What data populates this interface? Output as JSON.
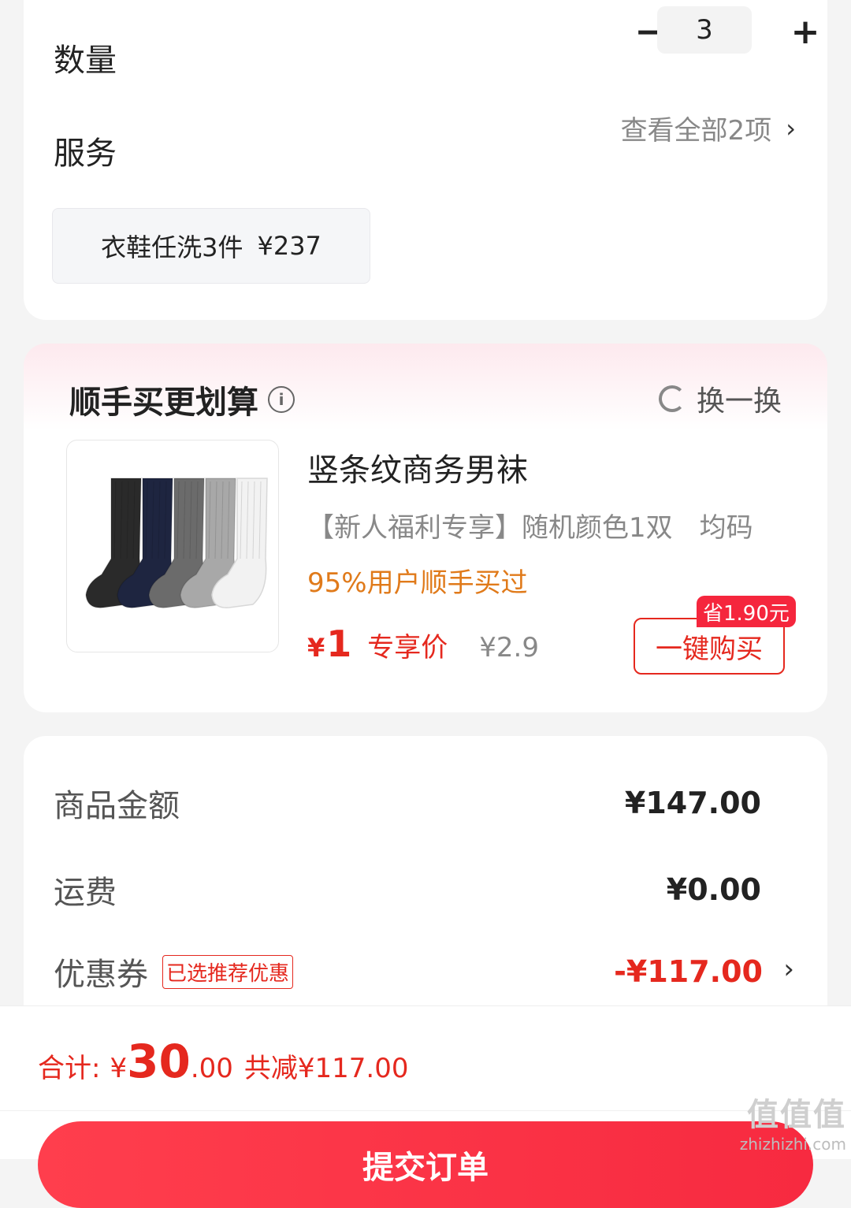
{
  "quantity": {
    "label": "数量",
    "minus": "−",
    "plus": "+",
    "value": "3"
  },
  "service": {
    "label": "服务",
    "view_all": "查看全部2项",
    "chevron": "›",
    "chip_name": "衣鞋任洗3件",
    "chip_price": "¥237"
  },
  "deal": {
    "title": "顺手买更划算",
    "info_icon": "ⓘ",
    "refresh_label": "换一换",
    "product": {
      "name": "竖条纹商务男袜",
      "spec": "【新人福利专享】随机颜色1双　均码",
      "popularity": "95%用户顺手买过",
      "price_currency": "¥",
      "price_value": "1",
      "price_tag": "专享价",
      "original_price": "¥2.9",
      "buy_button": "一键购买",
      "save_badge": "省1.90元",
      "image_icon": "socks-product-image",
      "sock_colors": [
        "#2a2a2a",
        "#1e2540",
        "#6b6b6b",
        "#a8a8a8",
        "#f2f2f2"
      ]
    }
  },
  "summary": {
    "items": [
      {
        "label": "商品金额",
        "value": "¥147.00"
      },
      {
        "label": "运费",
        "value": "¥0.00"
      },
      {
        "label": "优惠券",
        "tag": "已选推荐优惠",
        "value": "-¥117.00"
      }
    ],
    "chevron": "›"
  },
  "bottom": {
    "total_label": "合计:",
    "currency": "¥",
    "total_int": "30",
    "total_dec": ".00",
    "saved": "共减¥117.00",
    "submit_label": "提交订单"
  },
  "watermark": {
    "logo": "值值值",
    "url": "zhizhizhi.com"
  },
  "colors": {
    "accent_red": "#e5281e",
    "orange": "#e07a1a",
    "badge_red": "#f5263d"
  }
}
